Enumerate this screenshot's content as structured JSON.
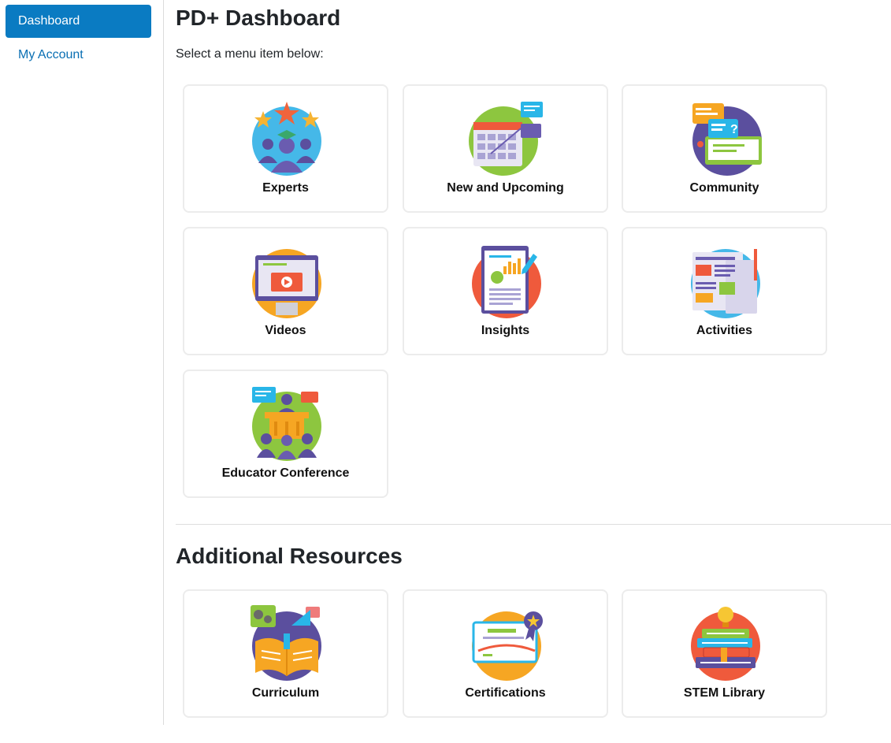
{
  "sidebar": {
    "items": [
      {
        "label": "Dashboard",
        "active": true
      },
      {
        "label": "My Account",
        "active": false
      }
    ]
  },
  "header": {
    "title": "PD+ Dashboard",
    "subtitle": "Select a menu item below:"
  },
  "menu": {
    "items": [
      {
        "label": "Experts",
        "icon": "experts-icon"
      },
      {
        "label": "New and Upcoming",
        "icon": "calendar-icon"
      },
      {
        "label": "Community",
        "icon": "chat-bubbles-icon"
      },
      {
        "label": "Videos",
        "icon": "video-player-icon"
      },
      {
        "label": "Insights",
        "icon": "report-chart-icon"
      },
      {
        "label": "Activities",
        "icon": "newspaper-icon"
      },
      {
        "label": "Educator Conference",
        "icon": "conference-podium-icon"
      }
    ]
  },
  "resources": {
    "title": "Additional Resources",
    "items": [
      {
        "label": "Curriculum",
        "icon": "open-book-icon"
      },
      {
        "label": "Certifications",
        "icon": "certificate-icon"
      },
      {
        "label": "STEM Library",
        "icon": "books-lightbulb-icon"
      }
    ]
  },
  "colors": {
    "accent": "#0a7bc2",
    "link": "#0a6fb3",
    "card_border": "#ececec"
  }
}
